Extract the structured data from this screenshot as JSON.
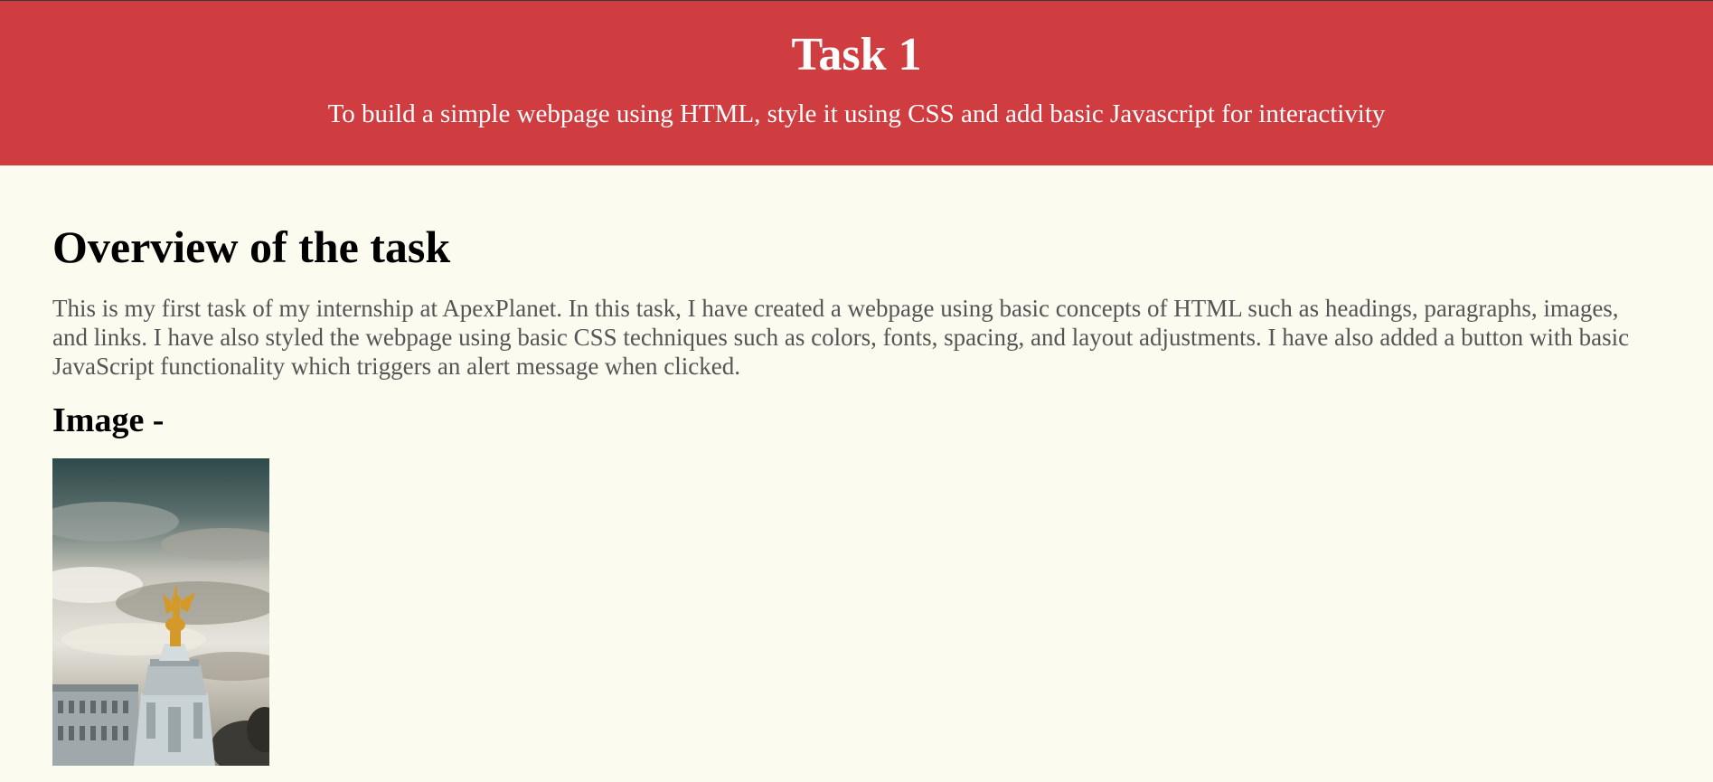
{
  "header": {
    "title": "Task 1",
    "subtitle": "To build a simple webpage using HTML, style it using CSS and add basic Javascript for interactivity"
  },
  "main": {
    "overview_heading": "Overview of the task",
    "overview_text": "This is my first task of my internship at ApexPlanet. In this task, I have created a webpage using basic concepts of HTML such as headings, paragraphs, images, and links. I have also styled the webpage using basic CSS techniques such as colors, fonts, spacing, and layout adjustments. I have also added a button with basic JavaScript functionality which triggers an alert message when clicked.",
    "image_heading": "Image -"
  },
  "colors": {
    "header_bg": "#d03d40",
    "page_bg": "#fbfbef",
    "body_text": "#555555"
  }
}
